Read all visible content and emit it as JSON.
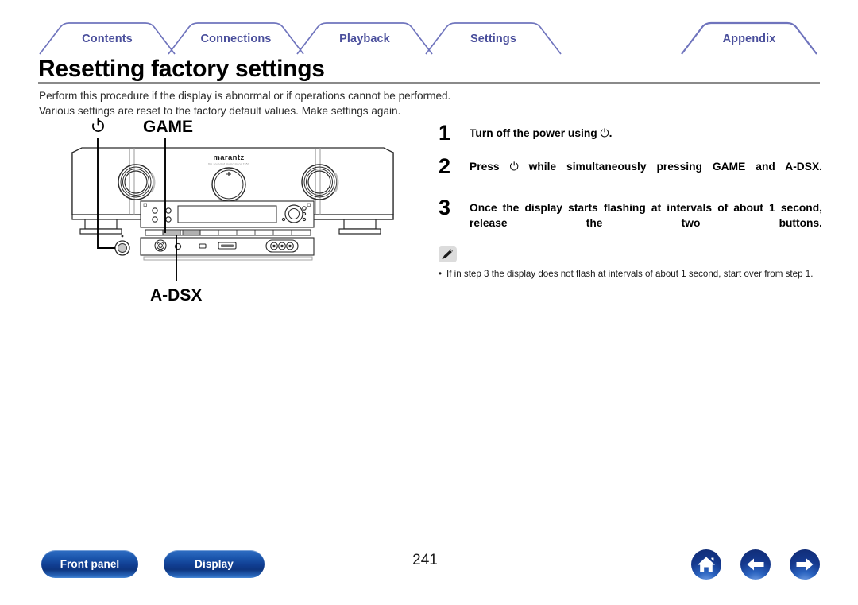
{
  "document": {
    "page_number": "241",
    "title": "Resetting factory settings"
  },
  "tabs": [
    {
      "label": "Contents",
      "active": false
    },
    {
      "label": "Connections",
      "active": false
    },
    {
      "label": "Playback",
      "active": false
    },
    {
      "label": "Settings",
      "active": false
    },
    {
      "label": "Appendix",
      "active": true
    }
  ],
  "intro": {
    "line1": "Perform this procedure if the display is abnormal or if operations cannot be performed.",
    "line2": "Various settings are reset to the factory default values. Make settings again."
  },
  "illustration": {
    "device_brand": "marantz",
    "device_brand_sub": "the sound of music since 1953",
    "callout_power": "⏻",
    "callout_game": "GAME",
    "callout_adsx": "A-DSX"
  },
  "steps": [
    {
      "number": "1",
      "text_before": "Turn off the power using ",
      "power_symbol": "⏻",
      "text_after": ".",
      "justified": false
    },
    {
      "number": "2",
      "text_before": "Press ",
      "power_symbol": "⏻",
      "text_after": " while simultaneously pressing GAME and A-DSX.",
      "justified": true
    },
    {
      "number": "3",
      "text_before": "Once the display starts flashing at intervals of about 1 second, release the two buttons.",
      "power_symbol": "",
      "text_after": "",
      "justified": true
    }
  ],
  "note": {
    "icon": "pencil-icon",
    "bullet_text": "If in step 3 the display does not flash at intervals of about 1 second, start over from step 1."
  },
  "footer": {
    "buttons": [
      {
        "label": "Front panel",
        "name": "front-panel-button"
      },
      {
        "label": "Display",
        "name": "display-button"
      }
    ],
    "nav_icons": [
      {
        "name": "home-icon",
        "glyph": "home"
      },
      {
        "name": "arrow-left-icon",
        "glyph": "back"
      },
      {
        "name": "arrow-right-icon",
        "glyph": "forward"
      }
    ]
  },
  "colors": {
    "tab_text": "#4a4f9c",
    "tab_border": "#6f74bd",
    "rule": "#8a8a8a",
    "button_blue": "#1c57ae",
    "nav_blue": "#14388d"
  }
}
